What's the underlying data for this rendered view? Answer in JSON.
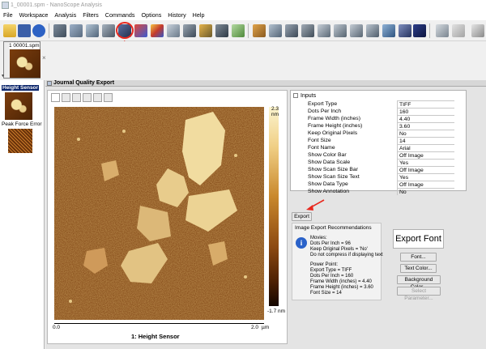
{
  "window_title": "1_00001.spm - NanoScope Analysis",
  "menu": [
    "File",
    "Workspace",
    "Analysis",
    "Filters",
    "Commands",
    "Options",
    "History",
    "Help"
  ],
  "colors": {
    "highlight_red": "#e8281e",
    "selection_blue": "#0a246a"
  },
  "thumbnails": {
    "file_label": "1 00001.spm"
  },
  "left_panel": {
    "channel1": "Height Sensor",
    "channel2": "Peak Force Error"
  },
  "export_window": {
    "title": "Journal Quality Export",
    "image": {
      "colorbar_max": "2.3 nm",
      "colorbar_min": "-1.7 nm",
      "x_start": "0.0",
      "x_end": "2.0",
      "x_unit": "µm",
      "caption": "1: Height Sensor"
    },
    "inputs_header": "Inputs",
    "inputs": [
      {
        "label": "Export Type",
        "value": "TIFF"
      },
      {
        "label": "Dots Per Inch",
        "value": "160"
      },
      {
        "label": "Frame Width (inches)",
        "value": "4.40"
      },
      {
        "label": "Frame Height (inches)",
        "value": "3.60"
      },
      {
        "label": "Keep Original Pixels",
        "value": "No"
      },
      {
        "label": "Font Size",
        "value": "14"
      },
      {
        "label": "Font Name",
        "value": "Arial"
      },
      {
        "label": "Show Color Bar",
        "value": "Off Image"
      },
      {
        "label": "Show Data Scale",
        "value": "Yes"
      },
      {
        "label": "Show Scan Size Bar",
        "value": "Off Image"
      },
      {
        "label": "Show Scan Size Text",
        "value": "Yes"
      },
      {
        "label": "Show Data Type",
        "value": "Off Image"
      },
      {
        "label": "Show Annotation",
        "value": "No"
      }
    ],
    "export_button": "Export",
    "recommendations": {
      "title": "Image Export Recommendations",
      "movies": [
        "Movies:",
        "Dots Per Inch = 96",
        "Keep Original Pixels = 'No'",
        "Do not compress if displaying text"
      ],
      "powerpoint": [
        "Power Point:",
        "Export Type = TIFF",
        "Dots Per Inch = 160",
        "Frame Width (inches) = 4.40",
        "Frame Height (inches) = 3.60",
        "Font Size = 14"
      ]
    },
    "font_preview": "Export Font",
    "buttons": {
      "font": "Font...",
      "text_color": "Text Color...",
      "background_color": "Background Color...",
      "select_parameter": "Select Parameter..."
    }
  }
}
